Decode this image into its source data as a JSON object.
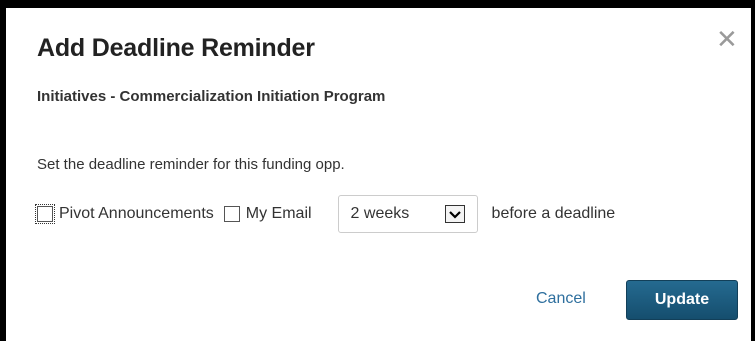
{
  "dialog": {
    "title": "Add Deadline Reminder",
    "subtitle": "Initiatives - Commercialization Initiation Program",
    "close_icon": "close-icon"
  },
  "form": {
    "instruction": "Set the deadline reminder for this funding opp.",
    "pivot_label": "Pivot Announcements",
    "pivot_checked": false,
    "email_label": "My Email",
    "email_checked": false,
    "period_value": "2 weeks",
    "after_text": "before a deadline"
  },
  "actions": {
    "cancel_label": "Cancel",
    "update_label": "Update"
  },
  "colors": {
    "primary_button": "#1d5c80",
    "link": "#2e6f9e",
    "close_icon": "#9a9a9a"
  }
}
